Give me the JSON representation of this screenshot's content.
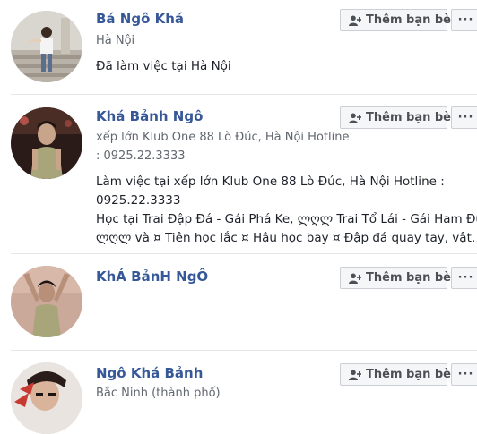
{
  "results": [
    {
      "name": "Bá Ngô Khá",
      "subtitle_lines": [
        "Hà Nội"
      ],
      "description_lines": [
        "Đã làm việc tại Hà Nội"
      ],
      "add_friend_label": "Thêm bạn bè",
      "more_label": "···",
      "avatar_icon": "profile-photo"
    },
    {
      "name": "Khá Bảnh Ngô",
      "subtitle_lines": [
        "xếp lớn Klub One 88 Lò Đúc, Hà Nội Hotline",
        ": 0925.22.3333"
      ],
      "description_lines": [
        "Làm việc tại xếp lớn Klub One 88 Lò Đúc, Hà Nội Hotline :",
        "0925.22.3333",
        "Học tại Trai Đập Đá - Gái Phá Ke, ლღლ Trai Tổ Lái - Gái Ham Đua",
        "ლღლ và ¤ Tiên học lắc ¤ Hậu học bay ¤ Đập đá quay tay, vật…"
      ],
      "add_friend_label": "Thêm bạn bè",
      "more_label": "···",
      "avatar_icon": "profile-photo"
    },
    {
      "name": "KhÁ BảnH NgÔ",
      "subtitle_lines": [],
      "description_lines": [],
      "add_friend_label": "Thêm bạn bè",
      "more_label": "···",
      "avatar_icon": "profile-photo"
    },
    {
      "name": "Ngô Khá Bảnh",
      "subtitle_lines": [
        "Bắc Ninh (thành phố)"
      ],
      "description_lines": [],
      "add_friend_label": "Thêm bạn bè",
      "more_label": "···",
      "avatar_icon": "profile-photo"
    }
  ],
  "colors": {
    "name": "#365899",
    "subtitle": "#616770",
    "text": "#1d2129",
    "button_bg": "#f5f6f7",
    "button_border": "#ccd0d5",
    "button_text": "#4b4f56",
    "divider": "#e5e6e9"
  },
  "icons": {
    "add_friend": "add-friend-icon",
    "more": "more-options-icon"
  }
}
